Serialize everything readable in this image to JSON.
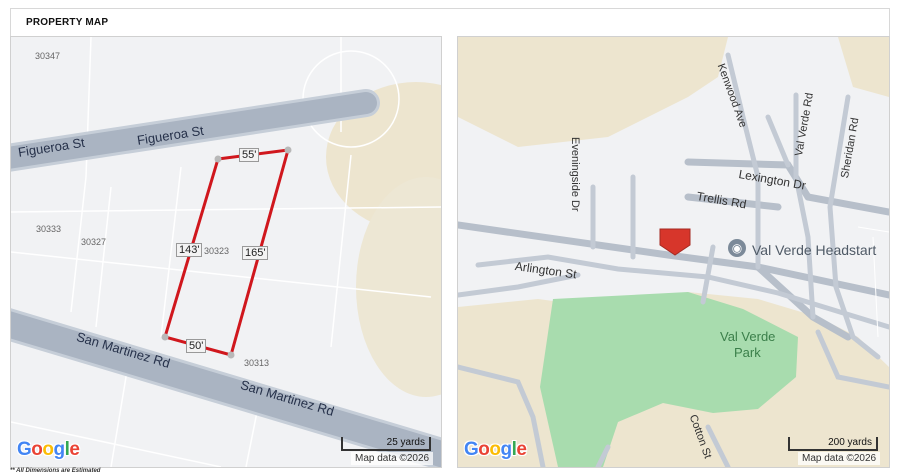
{
  "header": {
    "title": "PROPERTY MAP"
  },
  "left_map": {
    "parcels": [
      "30347",
      "30333",
      "30327",
      "30323",
      "30313"
    ],
    "streets": [
      "Figueroa St",
      "Figueroa St",
      "San Martinez Rd",
      "San Martinez Rd"
    ],
    "dimensions": [
      "55'",
      "143'",
      "165'",
      "50'"
    ],
    "scale_label": "25 yards",
    "attribution": "Map data ©2026"
  },
  "right_map": {
    "streets": [
      "Kenwood Ave",
      "Val Verde Rd",
      "Sheridan Rd",
      "Eveningside Dr",
      "Lexington Dr",
      "Trellis Rd",
      "Arlington St",
      "Cotton St"
    ],
    "places": [
      "Val Verde Headstart",
      "Val Verde",
      "Park"
    ],
    "scale_label": "200 yards",
    "attribution": "Map data ©2026"
  },
  "logo": {
    "g1": "G",
    "o1": "o",
    "o2": "o",
    "g2": "g",
    "l": "l",
    "e": "e"
  },
  "footnote": "** All Dimensions are Estimated",
  "colors": {
    "road": "#aab4c2",
    "boundary": "#d0171d",
    "park": "#a8dcae",
    "terrain": "#ebe4d2",
    "pin": "#d7362b"
  }
}
